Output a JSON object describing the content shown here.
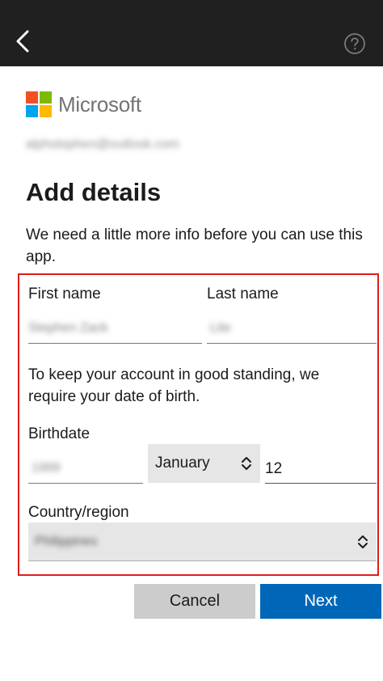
{
  "header": {
    "back_icon": "chevron-left-icon",
    "help_icon": "question-circle-icon"
  },
  "brand": {
    "name": "Microsoft",
    "colors": [
      "#f25022",
      "#7fba00",
      "#00a4ef",
      "#ffb900"
    ]
  },
  "account": {
    "email": "alphstephen@outlook.com"
  },
  "page": {
    "title": "Add details",
    "intro": "We need a little more info before you can use this app."
  },
  "form": {
    "first_name_label": "First name",
    "first_name_value": "Stephen Zack",
    "last_name_label": "Last name",
    "last_name_value": "Lite",
    "dob_notice": "To keep your account in good standing, we require your date of birth.",
    "birthdate_label": "Birthdate",
    "birth_year_value": "1999",
    "birth_month_value": "January",
    "birth_day_value": "12",
    "country_label": "Country/region",
    "country_value": "Philippines"
  },
  "actions": {
    "cancel_label": "Cancel",
    "next_label": "Next"
  },
  "colors": {
    "topbar": "#202020",
    "highlight": "#e01c1c",
    "primary": "#0067b8",
    "secondary": "#cccccc"
  }
}
